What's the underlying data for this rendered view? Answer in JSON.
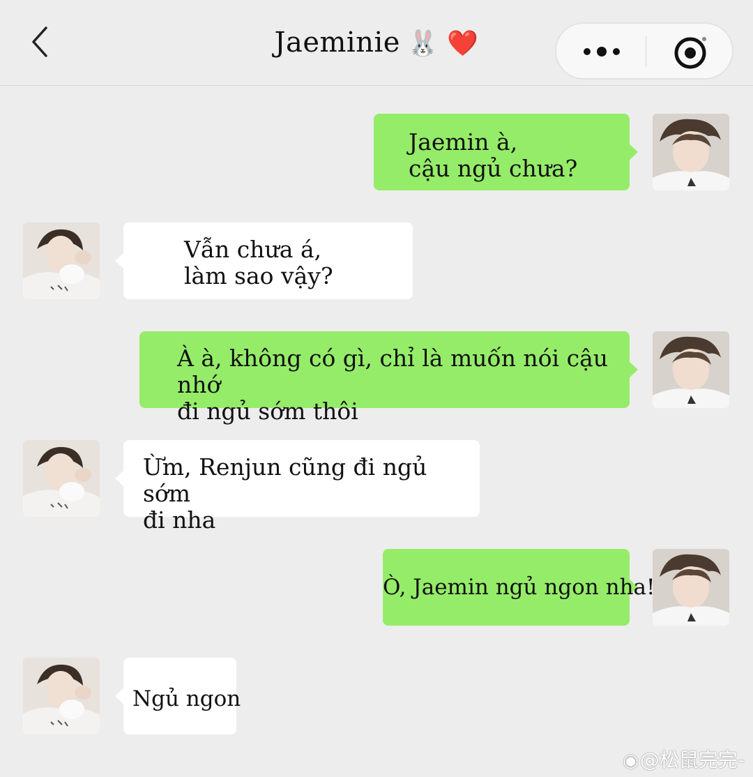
{
  "header": {
    "title": "Jaeminie",
    "title_emojis": "🐰 ❤️",
    "back_icon": "chevron-left-icon",
    "more_icon": "more-dots-icon",
    "record_icon": "record-target-icon"
  },
  "colors": {
    "sent_bubble": "#95ec69",
    "received_bubble": "#ffffff",
    "background": "#ededed"
  },
  "messages": [
    {
      "side": "sent",
      "text": "Jaemin à,\ncậu ngủ chưa?"
    },
    {
      "side": "received",
      "text": "Vẫn chưa á,\nlàm sao vậy?"
    },
    {
      "side": "sent",
      "text": "À à, không có gì, chỉ là muốn nói cậu nhớ\nđi ngủ sớm thôi"
    },
    {
      "side": "received",
      "text": "Ừm, Renjun cũng đi ngủ sớm\nđi nha"
    },
    {
      "side": "sent",
      "text": "Ò, Jaemin ngủ ngon nha!"
    },
    {
      "side": "received",
      "text": "Ngủ ngon"
    }
  ],
  "watermark": "@松鼠完完-"
}
